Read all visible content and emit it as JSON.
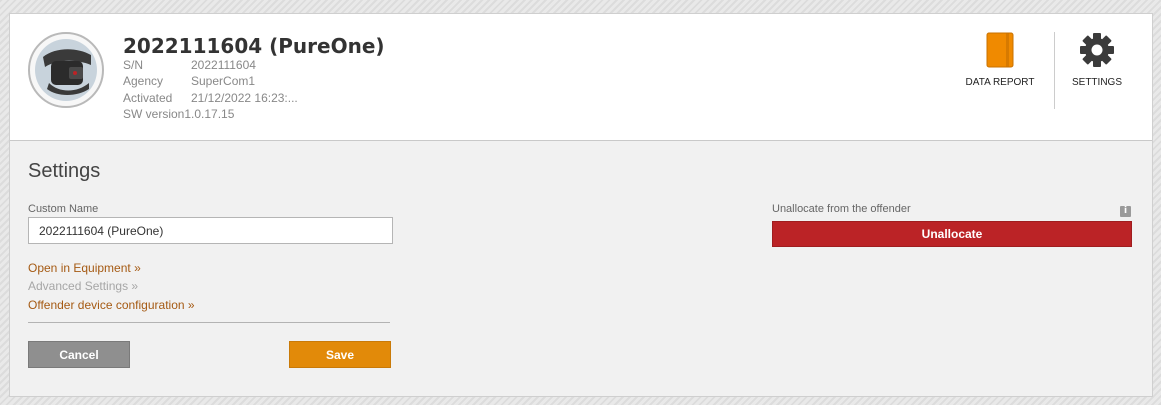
{
  "header": {
    "title": "2022111604 (PureOne)",
    "meta": [
      {
        "key": "S/N",
        "value": "2022111604"
      },
      {
        "key": "Agency",
        "value": "SuperCom1"
      },
      {
        "key": "Activated",
        "value": "21/12/2022 16:23:..."
      },
      {
        "key": "SW version",
        "value": "1.0.17.15"
      }
    ],
    "actions": {
      "data_report": "DATA REPORT",
      "settings": "SETTINGS"
    }
  },
  "settings": {
    "title": "Settings",
    "custom_name": {
      "label": "Custom Name",
      "value": "2022111604 (PureOne)"
    },
    "links": {
      "open_equipment": "Open in Equipment »",
      "advanced_settings": "Advanced Settings »",
      "offender_config": "Offender device configuration »"
    },
    "buttons": {
      "cancel": "Cancel",
      "save": "Save"
    },
    "unallocate": {
      "label": "Unallocate from the offender",
      "button": "Unallocate"
    }
  },
  "colors": {
    "accent_orange": "#e28a09",
    "danger_red": "#bb2326",
    "link_brown": "#a55a13"
  },
  "icons": {
    "data_report": "book-icon",
    "settings": "gear-icon",
    "info": "info-icon",
    "device": "ankle-monitor-icon"
  }
}
